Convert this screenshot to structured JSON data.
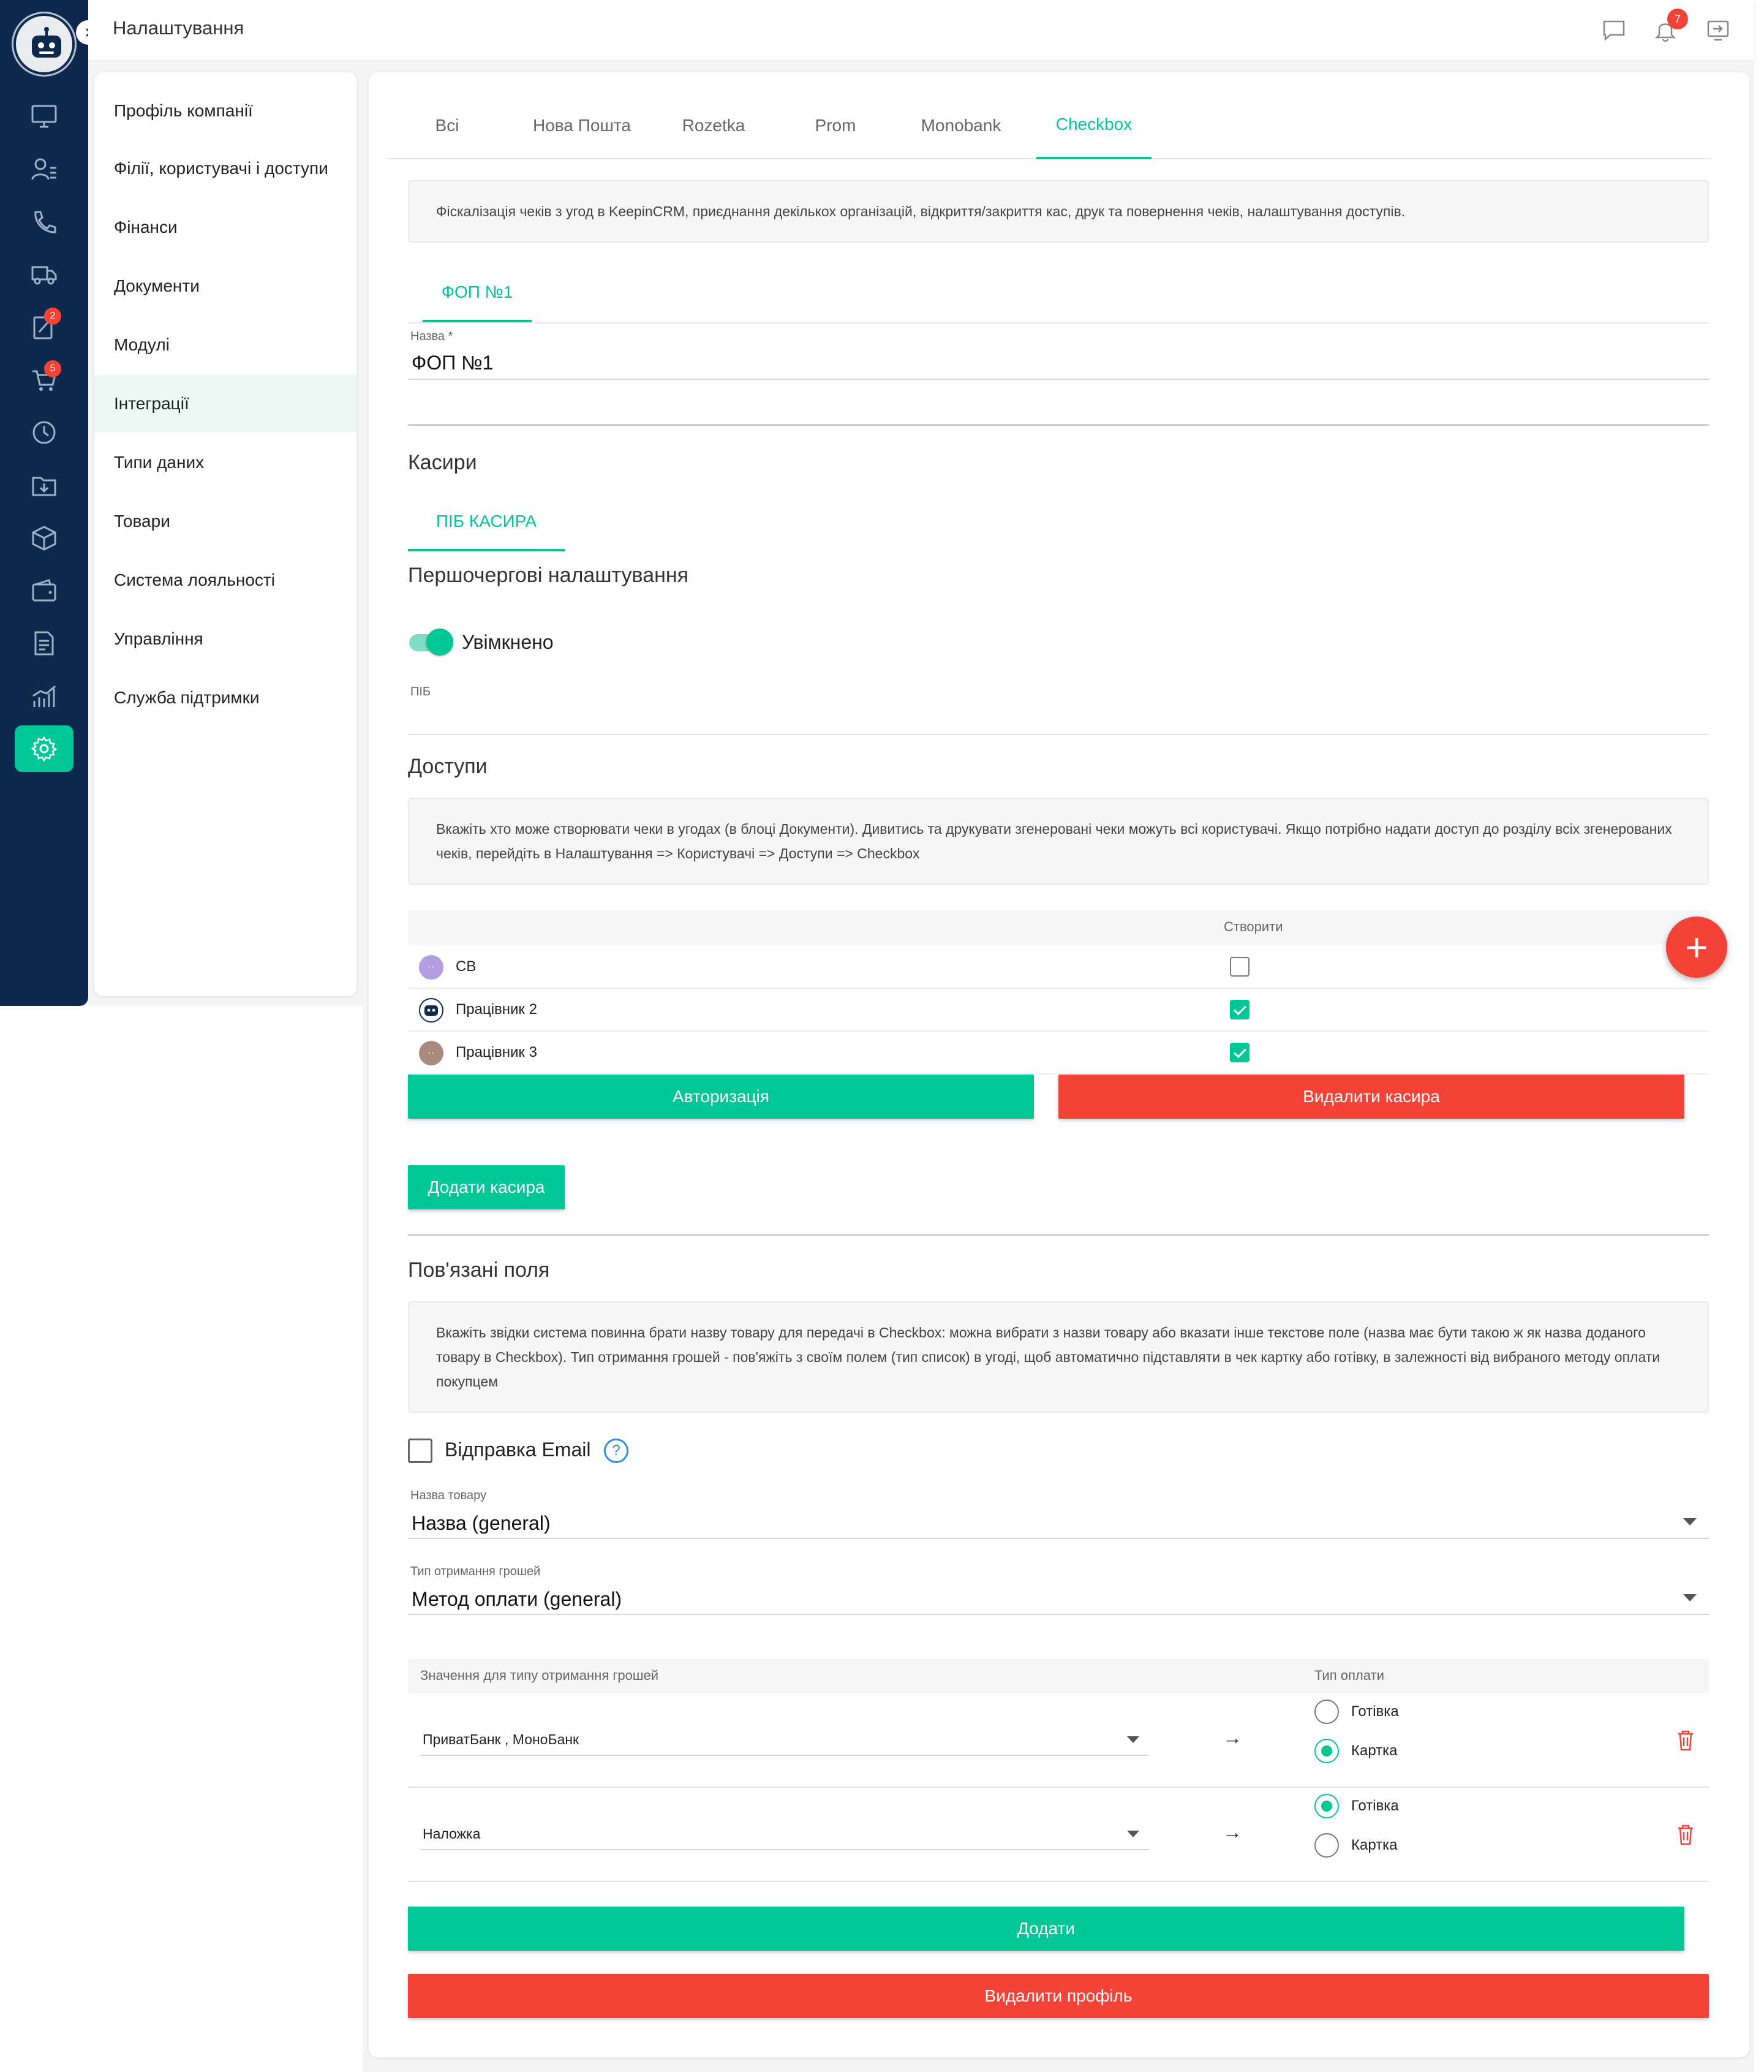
{
  "header": {
    "title": "Налаштування",
    "notifications_count": "7"
  },
  "rail": {
    "tasks_badge": "2",
    "orders_badge": "5"
  },
  "settings_menu": [
    "Профіль компанії",
    "Філії, користувачі і доступи",
    "Фінанси",
    "Документи",
    "Модулі",
    "Інтеграції",
    "Типи даних",
    "Товари",
    "Система лояльності",
    "Управління",
    "Служба підтримки"
  ],
  "tabs": [
    "Всі",
    "Нова Пошта",
    "Rozetka",
    "Prom",
    "Monobank",
    "Checkbox"
  ],
  "active_tab": "Checkbox",
  "intro": "Фіскалізація чеків з угод в KeepinCRM, приєднання декількох організацій, відкриття/закриття кас, друк та повернення чеків, налаштування доступів.",
  "org_tab": "ФОП №1",
  "name_field": {
    "label": "Назва *",
    "value": "ФОП №1"
  },
  "cashiers": {
    "title": "Касири",
    "cashier_tab": "ПІБ КАСИРА",
    "primary_settings": "Першочергові налаштування",
    "toggle_label": "Увімкнено",
    "pib_label": "ПІБ"
  },
  "access": {
    "title": "Доступи",
    "info": "Вкажіть хто може створювати чеки в угодах (в блоці Документи). Дивитись та друкувати згенеровані чеки можуть всі користувачі. Якщо потрібно надати доступ до розділу всіх згенерованих чеків, перейдіть в Налаштування => Користувачі => Доступи => Checkbox",
    "column_create": "Створити",
    "users": [
      {
        "name": "СВ",
        "create": false
      },
      {
        "name": "Працівник 2",
        "create": true
      },
      {
        "name": "Працівник 3",
        "create": true
      }
    ],
    "auth_button": "Авторизація",
    "delete_cashier_button": "Видалити касира",
    "add_cashier_button": "Додати касира"
  },
  "linked": {
    "title": "Пов'язані поля",
    "info": "Вкажіть звідки система повинна брати назву товару для передачі в Checkbox: можна вибрати з назви товару або вказати інше текстове поле (назва має бути такою ж як назва доданого товару в Checkbox). Тип отримання грошей - пов'яжіть з своїм полем (тип список) в угоді, щоб автоматично підставляти в чек картку або готівку, в залежності від вибраного методу оплати покупцем",
    "email_label": "Відправка Email",
    "email_checked": false,
    "product_name": {
      "label": "Назва товару",
      "value": "Назва (general)"
    },
    "money_type": {
      "label": "Тип отримання грошей",
      "value": "Метод оплати (general)"
    },
    "map_header_values": "Значення для типу отримання грошей",
    "map_header_payment": "Тип оплати",
    "payment_options": [
      "Готівка",
      "Картка"
    ],
    "rows": [
      {
        "value": "ПриватБанк , МоноБанк",
        "selected": "Картка"
      },
      {
        "value": "Наложка",
        "selected": "Готівка"
      }
    ],
    "add_button": "Додати",
    "delete_profile_button": "Видалити профіль"
  },
  "colors": {
    "accent": "#00c796",
    "danger": "#f44336",
    "rail": "#0d2a4e"
  }
}
